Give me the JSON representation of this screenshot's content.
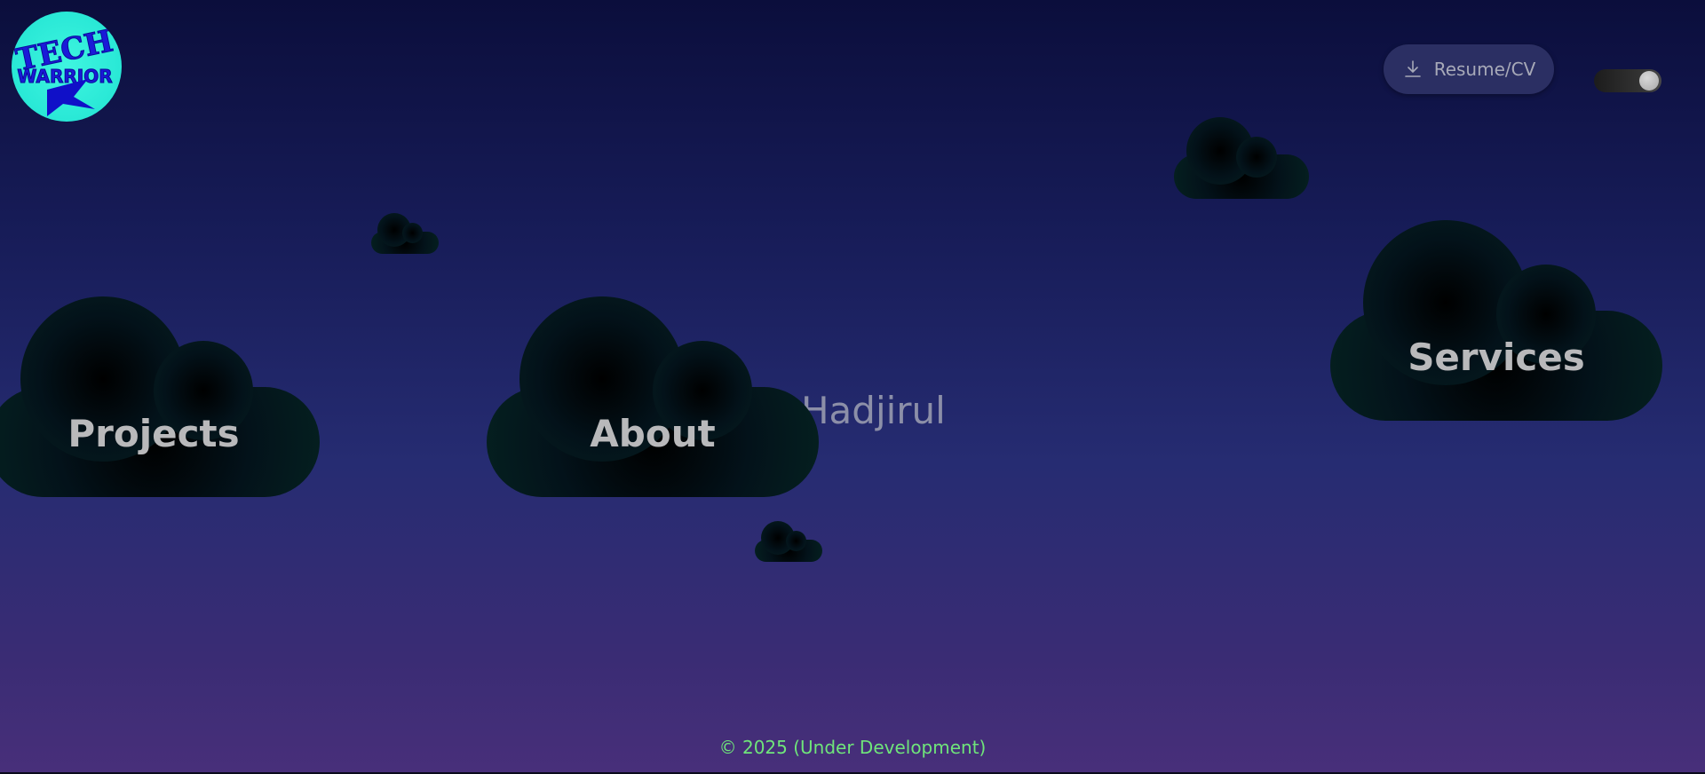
{
  "header": {
    "logo_text": "TECH WARRIOR",
    "resume_label": "Resume/CV",
    "theme_toggle": "on"
  },
  "hero": {
    "name_fragment": "n Hadjirul"
  },
  "nav": {
    "projects": "Projects",
    "about": "About",
    "services": "Services"
  },
  "footer": {
    "text": "© 2025 (Under Development)"
  },
  "colors": {
    "logo_bg": "#29e8d6",
    "logo_text": "#1414d0",
    "footer_text": "#6fe57a",
    "nav_label": "#b9b9bb"
  }
}
